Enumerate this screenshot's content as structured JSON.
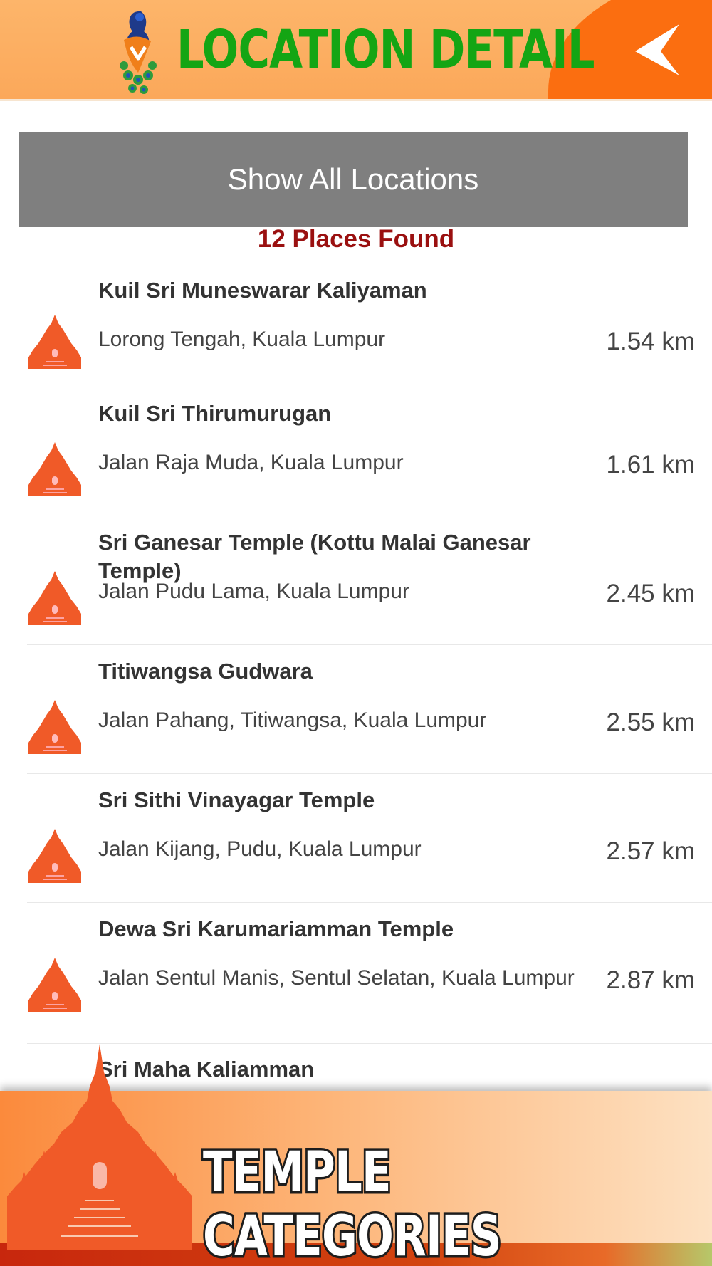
{
  "header": {
    "title": "LOCATION DETAIL",
    "colors": {
      "background": "#fba85a",
      "accent": "#fb6e10",
      "title": "#14a514"
    }
  },
  "show_all_label": "Show All Locations",
  "places_found": "12 Places Found",
  "items": [
    {
      "name": "Kuil Sri Muneswarar Kaliyaman",
      "address": "Lorong Tengah, Kuala Lumpur",
      "distance": "1.54 km"
    },
    {
      "name": "Kuil Sri Thirumurugan",
      "address": "Jalan Raja Muda, Kuala Lumpur",
      "distance": "1.61 km"
    },
    {
      "name": "Sri Ganesar Temple (Kottu Malai Ganesar Temple)",
      "address": "Jalan Pudu Lama, Kuala Lumpur",
      "distance": "2.45 km"
    },
    {
      "name": "Titiwangsa Gudwara",
      "address": "Jalan Pahang, Titiwangsa, Kuala Lumpur",
      "distance": "2.55 km"
    },
    {
      "name": "Sri Sithi Vinayagar Temple",
      "address": "Jalan Kijang, Pudu, Kuala Lumpur",
      "distance": "2.57 km"
    },
    {
      "name": "Dewa Sri Karumariamman Temple",
      "address": "Jalan Sentul Manis, Sentul Selatan, Kuala Lumpur",
      "distance": "2.87 km"
    },
    {
      "name": "Sri Maha Kaliamman",
      "address": "",
      "distance": ""
    }
  ],
  "banner": {
    "title": "TEMPLE CATEGORIES"
  },
  "icons": {
    "temple": "temple-icon",
    "back": "back-arrow-icon",
    "logo": "peacock-logo-icon"
  }
}
